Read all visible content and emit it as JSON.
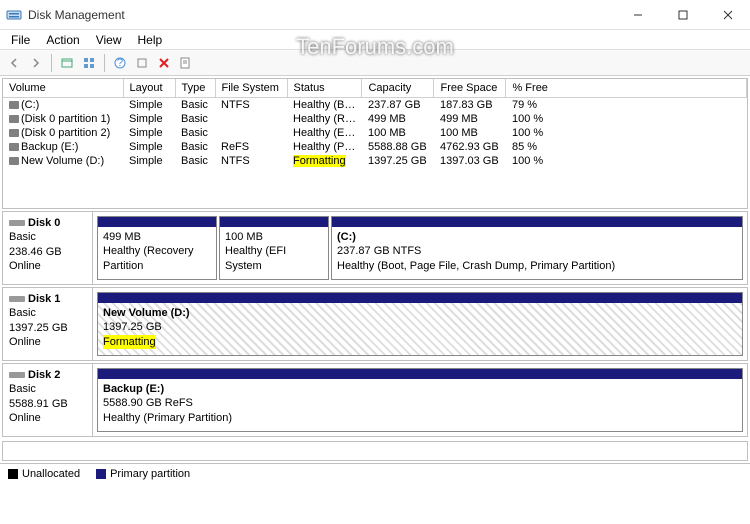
{
  "window": {
    "title": "Disk Management"
  },
  "menu": {
    "file": "File",
    "action": "Action",
    "view": "View",
    "help": "Help"
  },
  "watermark": "TenForums.com",
  "columns": {
    "volume": "Volume",
    "layout": "Layout",
    "type": "Type",
    "fs": "File System",
    "status": "Status",
    "capacity": "Capacity",
    "free": "Free Space",
    "pct": "% Free"
  },
  "volumes": [
    {
      "name": "(C:)",
      "layout": "Simple",
      "type": "Basic",
      "fs": "NTFS",
      "status": "Healthy (B…",
      "capacity": "237.87 GB",
      "free": "187.83 GB",
      "pct": "79 %",
      "hl": false
    },
    {
      "name": "(Disk 0 partition 1)",
      "layout": "Simple",
      "type": "Basic",
      "fs": "",
      "status": "Healthy (R…",
      "capacity": "499 MB",
      "free": "499 MB",
      "pct": "100 %",
      "hl": false
    },
    {
      "name": "(Disk 0 partition 2)",
      "layout": "Simple",
      "type": "Basic",
      "fs": "",
      "status": "Healthy (E…",
      "capacity": "100 MB",
      "free": "100 MB",
      "pct": "100 %",
      "hl": false
    },
    {
      "name": "Backup (E:)",
      "layout": "Simple",
      "type": "Basic",
      "fs": "ReFS",
      "status": "Healthy (P…",
      "capacity": "5588.88 GB",
      "free": "4762.93 GB",
      "pct": "85 %",
      "hl": false
    },
    {
      "name": "New Volume (D:)",
      "layout": "Simple",
      "type": "Basic",
      "fs": "NTFS",
      "status": "Formatting",
      "capacity": "1397.25 GB",
      "free": "1397.03 GB",
      "pct": "100 %",
      "hl": true
    }
  ],
  "disks": {
    "d0": {
      "name": "Disk 0",
      "type": "Basic",
      "size": "238.46 GB",
      "status": "Online",
      "p0": {
        "size": "499 MB",
        "status": "Healthy (Recovery Partition"
      },
      "p1": {
        "size": "100 MB",
        "status": "Healthy (EFI System"
      },
      "p2": {
        "title": "(C:)",
        "size": "237.87 GB NTFS",
        "status": "Healthy (Boot, Page File, Crash Dump, Primary Partition)"
      }
    },
    "d1": {
      "name": "Disk 1",
      "type": "Basic",
      "size": "1397.25 GB",
      "status": "Online",
      "p0": {
        "title": "New Volume  (D:)",
        "size": "1397.25 GB",
        "status": "Formatting"
      }
    },
    "d2": {
      "name": "Disk 2",
      "type": "Basic",
      "size": "5588.91 GB",
      "status": "Online",
      "p0": {
        "title": "Backup  (E:)",
        "size": "5588.90 GB ReFS",
        "status": "Healthy (Primary Partition)"
      }
    }
  },
  "legend": {
    "unalloc": "Unallocated",
    "primary": "Primary partition"
  }
}
